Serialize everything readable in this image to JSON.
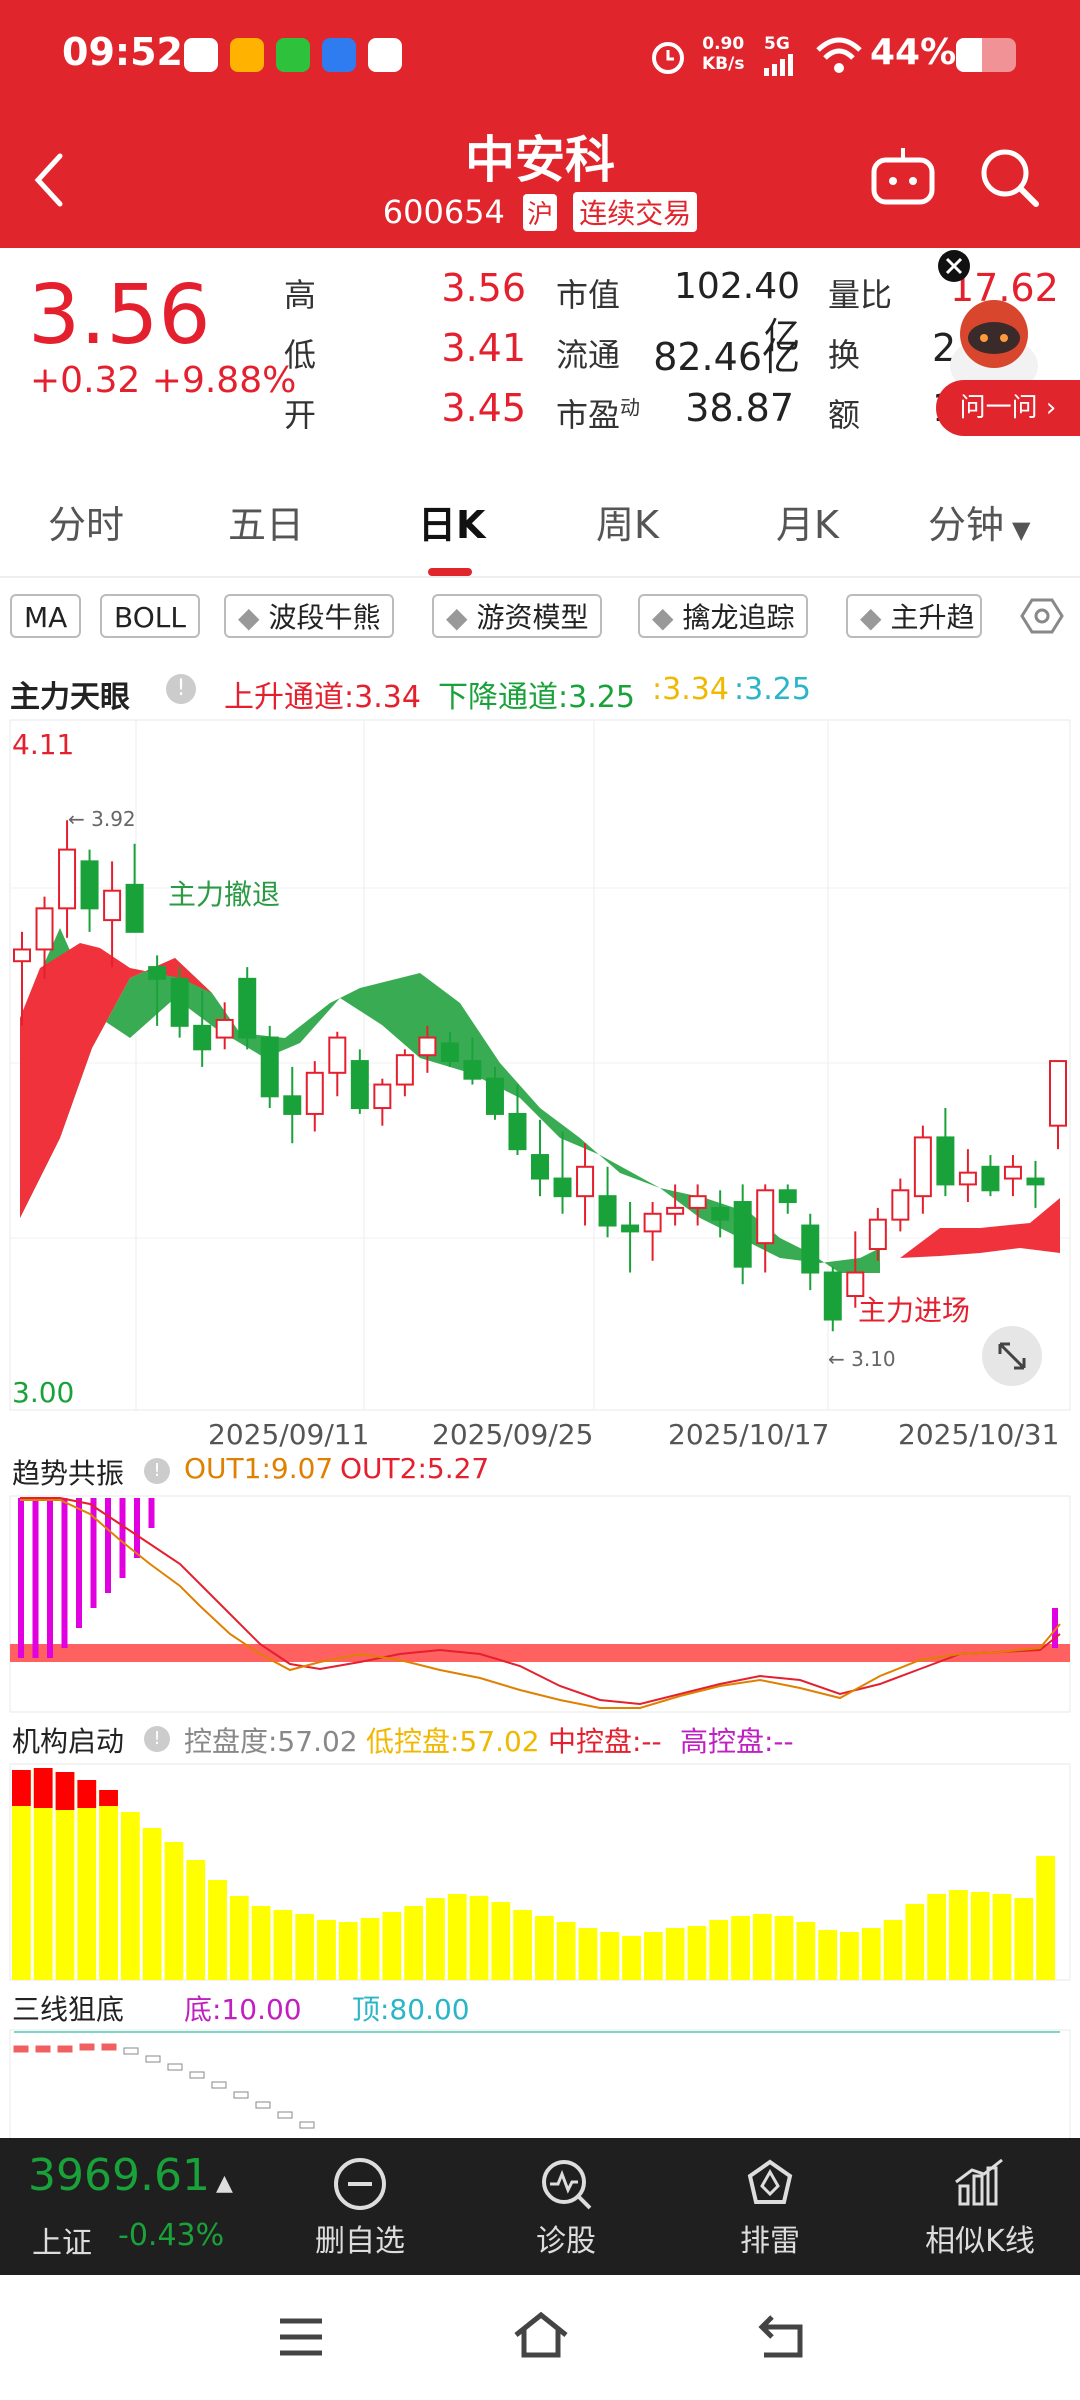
{
  "status": {
    "time": "09:52",
    "speed_top": "0.90",
    "speed_unit": "KB/s",
    "signal": "5G",
    "battery": "44%"
  },
  "header": {
    "title": "中安科",
    "code": "600654",
    "exchange": "沪",
    "trade_status": "连续交易"
  },
  "quote": {
    "price": "3.56",
    "change": "+0.32",
    "change_pct": "+9.88%",
    "high_label": "高",
    "high": "3.56",
    "low_label": "低",
    "low": "3.41",
    "open_label": "开",
    "open": "3.45",
    "mcap_label": "市值",
    "mcap": "102.40亿",
    "float_label": "流通",
    "float": "82.46亿",
    "pe_label": "市盈",
    "pe_sup": "动",
    "pe": "38.87",
    "vr_label": "量比",
    "vr": "17.62",
    "turn_label": "换",
    "turn": "2.",
    "amt_label": "额",
    "amt": "1",
    "ask_btn": "问一问 ›"
  },
  "tabs": [
    "分时",
    "五日",
    "日K",
    "周K",
    "月K",
    "分钟"
  ],
  "active_tab": "日K",
  "indicators": [
    "MA",
    "BOLL",
    "波段牛熊",
    "游资模型",
    "擒龙追踪",
    "主升趋"
  ],
  "main_chart": {
    "name": "主力天眼",
    "up_channel": "上升通道:3.34",
    "down_channel": "下降通道:3.25",
    "v1": ":3.34",
    "v2": ":3.25",
    "y_max": "4.11",
    "y_min": "3.00",
    "high_mark": "← 3.92",
    "low_mark": "← 3.10",
    "annot_exit": "主力撤退",
    "annot_enter": "主力进场",
    "dates": [
      "2025/09/11",
      "2025/09/25",
      "2025/10/17",
      "2025/10/31"
    ]
  },
  "chart_data": {
    "type": "candlestick",
    "ylim": [
      3.0,
      4.11
    ],
    "x_ticks": [
      "2025/09/11",
      "2025/09/25",
      "2025/10/17",
      "2025/10/31"
    ],
    "ohlc": [
      [
        3.73,
        3.78,
        3.62,
        3.75
      ],
      [
        3.75,
        3.84,
        3.7,
        3.82
      ],
      [
        3.82,
        3.97,
        3.77,
        3.92
      ],
      [
        3.9,
        3.92,
        3.78,
        3.82
      ],
      [
        3.8,
        3.9,
        3.72,
        3.85
      ],
      [
        3.86,
        3.93,
        3.78,
        3.78
      ],
      [
        3.72,
        3.74,
        3.62,
        3.7
      ],
      [
        3.7,
        3.72,
        3.6,
        3.62
      ],
      [
        3.62,
        3.68,
        3.55,
        3.58
      ],
      [
        3.6,
        3.66,
        3.58,
        3.63
      ],
      [
        3.7,
        3.72,
        3.58,
        3.6
      ],
      [
        3.6,
        3.62,
        3.48,
        3.5
      ],
      [
        3.5,
        3.55,
        3.42,
        3.47
      ],
      [
        3.47,
        3.56,
        3.44,
        3.54
      ],
      [
        3.54,
        3.61,
        3.5,
        3.6
      ],
      [
        3.56,
        3.58,
        3.47,
        3.48
      ],
      [
        3.48,
        3.53,
        3.45,
        3.52
      ],
      [
        3.52,
        3.58,
        3.5,
        3.57
      ],
      [
        3.57,
        3.62,
        3.54,
        3.6
      ],
      [
        3.59,
        3.61,
        3.55,
        3.56
      ],
      [
        3.56,
        3.6,
        3.52,
        3.53
      ],
      [
        3.53,
        3.55,
        3.46,
        3.47
      ],
      [
        3.47,
        3.52,
        3.4,
        3.41
      ],
      [
        3.4,
        3.46,
        3.33,
        3.36
      ],
      [
        3.36,
        3.44,
        3.3,
        3.33
      ],
      [
        3.33,
        3.42,
        3.28,
        3.38
      ],
      [
        3.33,
        3.38,
        3.26,
        3.28
      ],
      [
        3.28,
        3.32,
        3.2,
        3.27
      ],
      [
        3.27,
        3.32,
        3.22,
        3.3
      ],
      [
        3.3,
        3.35,
        3.28,
        3.31
      ],
      [
        3.31,
        3.35,
        3.28,
        3.33
      ],
      [
        3.31,
        3.34,
        3.26,
        3.29
      ],
      [
        3.32,
        3.35,
        3.18,
        3.21
      ],
      [
        3.25,
        3.35,
        3.2,
        3.34
      ],
      [
        3.34,
        3.35,
        3.3,
        3.32
      ],
      [
        3.28,
        3.3,
        3.17,
        3.2
      ],
      [
        3.2,
        3.21,
        3.1,
        3.12
      ],
      [
        3.16,
        3.27,
        3.14,
        3.2
      ],
      [
        3.24,
        3.31,
        3.22,
        3.29
      ],
      [
        3.29,
        3.36,
        3.27,
        3.34
      ],
      [
        3.33,
        3.45,
        3.3,
        3.43
      ],
      [
        3.43,
        3.48,
        3.33,
        3.35
      ],
      [
        3.35,
        3.41,
        3.32,
        3.37
      ],
      [
        3.38,
        3.4,
        3.33,
        3.34
      ],
      [
        3.36,
        3.4,
        3.33,
        3.38
      ],
      [
        3.36,
        3.39,
        3.31,
        3.35
      ],
      [
        3.45,
        3.56,
        3.41,
        3.56
      ]
    ]
  },
  "sub1": {
    "name": "趋势共振",
    "out1": "OUT1:9.07",
    "out2": "OUT2:5.27"
  },
  "sub2": {
    "name": "机构启动",
    "ctrl": "控盘度:57.02",
    "low": "低控盘:57.02",
    "mid": "中控盘:--",
    "high": "高控盘:--"
  },
  "sub3": {
    "name": "三线狙底",
    "bottom": "底:10.00",
    "top": "顶:80.00"
  },
  "bottom_bar": {
    "index_value": "3969.61",
    "index_name": "上证",
    "index_change": "-0.43%",
    "actions": [
      {
        "label": "删自选",
        "icon": "minus-circle-icon"
      },
      {
        "label": "诊股",
        "icon": "diagnose-icon"
      },
      {
        "label": "排雷",
        "icon": "mine-icon"
      },
      {
        "label": "相似K线",
        "icon": "similar-kline-icon"
      }
    ]
  },
  "colors": {
    "brand_red": "#e1252d",
    "up": "#e5202e",
    "down": "#1aa23a",
    "bar_yellow": "#ffff00",
    "bar_magenta": "#e000e0"
  }
}
